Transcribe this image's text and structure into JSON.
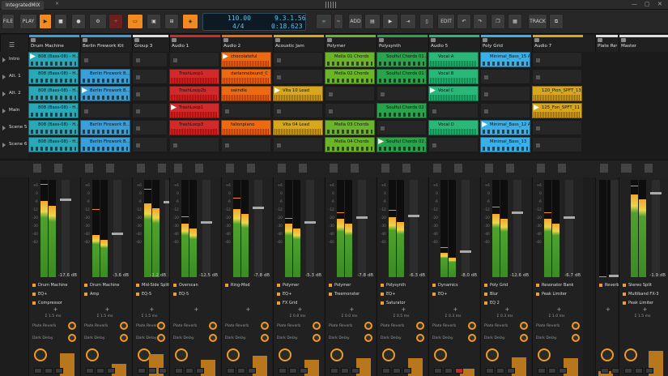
{
  "window": {
    "tab_title": "IntegratedMIX",
    "tab_close": "×",
    "controls": [
      "—",
      "▢",
      "✕"
    ]
  },
  "toolbar": {
    "file": "FILE",
    "play_label": "PLAY",
    "add": "ADD",
    "edit": "EDIT",
    "track": "TRACK"
  },
  "transport": {
    "tempo": "110.00",
    "signature": "4/4",
    "position": "9.3.1.56",
    "time": "0:18.623"
  },
  "tracks": [
    {
      "name": "Drum Machine",
      "color": "#3a9fd8"
    },
    {
      "name": "Berlin Firework Kit",
      "color": "#3a9fd8"
    },
    {
      "name": "Group 3",
      "color": "#dedede"
    },
    {
      "name": "Audio 1",
      "color": "#d02a2a"
    },
    {
      "name": "Audio 2",
      "color": "#ec6a12"
    },
    {
      "name": "Acoustic Jam",
      "color": "#d7a81e"
    },
    {
      "name": "Polymer",
      "color": "#6bb52a"
    },
    {
      "name": "Polysynth",
      "color": "#2aa34c"
    },
    {
      "name": "Audio 5",
      "color": "#2ab87a"
    },
    {
      "name": "Poly Grid",
      "color": "#3bb0e8"
    },
    {
      "name": "Audio 7",
      "color": "#d7a81e"
    },
    {
      "name": "Plate Reverb",
      "color": "#dedede"
    },
    {
      "name": "Master",
      "color": "#dedede"
    }
  ],
  "scenes": [
    "Intro",
    "Alt. 1",
    "Alt. 2",
    "Main",
    "Scene 5",
    "Scene 6"
  ],
  "clips": [
    {
      "t": 0,
      "s": 0,
      "name": "808 (Bass-08) - H...",
      "color": "#2aa8b8",
      "play": true
    },
    {
      "t": 0,
      "s": 1,
      "name": "808 (Bass-08) - H...",
      "color": "#2aa8b8"
    },
    {
      "t": 0,
      "s": 2,
      "name": "808 (Bass-08) - H...",
      "color": "#2aa8b8"
    },
    {
      "t": 0,
      "s": 3,
      "name": "808 (Bass-08) - H...",
      "color": "#2aa8b8"
    },
    {
      "t": 0,
      "s": 4,
      "name": "808 (Bass-08) - H...",
      "color": "#2aa8b8"
    },
    {
      "t": 0,
      "s": 5,
      "name": "808 (Bass-08) - H...",
      "color": "#2aa8b8"
    },
    {
      "t": 1,
      "s": 1,
      "name": "Berlin Firework B...",
      "color": "#3a9fd8"
    },
    {
      "t": 1,
      "s": 2,
      "name": "Berlin Firework B...",
      "color": "#3a9fd8",
      "play": true
    },
    {
      "t": 1,
      "s": 4,
      "name": "Berlin Firework B...",
      "color": "#3a9fd8"
    },
    {
      "t": 1,
      "s": 5,
      "name": "Berlin Firework B...",
      "color": "#3a9fd8"
    },
    {
      "t": 3,
      "s": 1,
      "name": "TrashLoop1",
      "color": "#d02a2a"
    },
    {
      "t": 3,
      "s": 2,
      "name": "TrashLoop2b",
      "color": "#d02a2a"
    },
    {
      "t": 3,
      "s": 3,
      "name": "TrashLoop1",
      "color": "#d02a2a",
      "play": true
    },
    {
      "t": 3,
      "s": 4,
      "name": "TrashLoop3",
      "color": "#d02a2a"
    },
    {
      "t": 4,
      "s": 0,
      "name": "chocolateful",
      "color": "#ec6a12",
      "play": true
    },
    {
      "t": 4,
      "s": 1,
      "name": "darlannebsund_C",
      "color": "#ec6a12"
    },
    {
      "t": 4,
      "s": 2,
      "name": "swindle",
      "color": "#ec6a12"
    },
    {
      "t": 4,
      "s": 4,
      "name": "fallonpiano",
      "color": "#ec6a12"
    },
    {
      "t": 5,
      "s": 2,
      "name": "Vita 10 Lead",
      "color": "#d7a81e",
      "play": true
    },
    {
      "t": 5,
      "s": 4,
      "name": "Vita 04 Lead",
      "color": "#d7a81e"
    },
    {
      "t": 6,
      "s": 0,
      "name": "Mella 01 Chords",
      "color": "#6bb52a"
    },
    {
      "t": 6,
      "s": 1,
      "name": "Mella 02 Chords",
      "color": "#6bb52a"
    },
    {
      "t": 6,
      "s": 4,
      "name": "Mella 03 Chords",
      "color": "#6bb52a"
    },
    {
      "t": 6,
      "s": 5,
      "name": "Mella 04 Chords",
      "color": "#6bb52a"
    },
    {
      "t": 7,
      "s": 0,
      "name": "Soulful Chords 01 A",
      "color": "#2aa34c"
    },
    {
      "t": 7,
      "s": 1,
      "name": "Soulful Chords 01 B",
      "color": "#2aa34c"
    },
    {
      "t": 7,
      "s": 3,
      "name": "Soulful Chords 02 B",
      "color": "#2aa34c"
    },
    {
      "t": 7,
      "s": 5,
      "name": "Soulful Chords 02 A",
      "color": "#2aa34c",
      "play": true
    },
    {
      "t": 8,
      "s": 0,
      "name": "Vocal A",
      "color": "#2ab87a"
    },
    {
      "t": 8,
      "s": 1,
      "name": "Vocal B",
      "color": "#2ab87a"
    },
    {
      "t": 8,
      "s": 2,
      "name": "Vocal C",
      "color": "#2ab87a",
      "play": true
    },
    {
      "t": 8,
      "s": 4,
      "name": "Vocal D",
      "color": "#2ab87a"
    },
    {
      "t": 9,
      "s": 0,
      "name": "Minimal_Bass_15 A",
      "color": "#3bb0e8"
    },
    {
      "t": 9,
      "s": 4,
      "name": "Minimal_Bass_12 A",
      "color": "#3bb0e8",
      "play": true
    },
    {
      "t": 9,
      "s": 5,
      "name": "Minimal_Bass_13",
      "color": "#3bb0e8"
    },
    {
      "t": 10,
      "s": 2,
      "name": "120_Pion_SPFT_13",
      "color": "#d7a81e"
    },
    {
      "t": 10,
      "s": 3,
      "name": "125_Fon_SPFT_11",
      "color": "#d7a81e",
      "play": true
    }
  ],
  "mixer": [
    {
      "db": "-17.6 dB",
      "level": 0.78,
      "peak": 0.95,
      "d1": "Drum Machine",
      "d2": "EQ+",
      "d3": "Compressor",
      "lat": "Σ 1.5 ms",
      "k1": "Plate Reverb",
      "k2": "Dark Delay"
    },
    {
      "db": "-3.6 dB",
      "level": 0.43,
      "peak": 0.69,
      "d1": "Drum Machine",
      "d2": "Amp",
      "d3": "",
      "lat": "Σ 1.5 ms",
      "k1": "Plate Reverb",
      "k2": "Dark Delay"
    },
    {
      "db": "-2.2 dB",
      "level": 0.76,
      "peak": 0.9,
      "d1": "Mid-Side Split",
      "d2": "EQ-5",
      "d3": "",
      "lat": "Σ 1.5 ms",
      "k1": "Plate Reverb",
      "k2": "Dark Delay"
    },
    {
      "db": "-12.5 dB",
      "level": 0.55,
      "peak": 0.62,
      "d1": "Overscan",
      "d2": "EQ-5",
      "d3": "",
      "lat": "",
      "k1": "Plate Reverb",
      "k2": "Dark Delay"
    },
    {
      "db": "-7.8 dB",
      "level": 0.7,
      "peak": 0.81,
      "d1": "Ring-Mod",
      "d2": "",
      "d3": "",
      "lat": "",
      "k1": "Plate Reverb",
      "k2": "Dark Delay"
    },
    {
      "db": "-5.3 dB",
      "level": 0.55,
      "peak": 0.6,
      "d1": "Polymer",
      "d2": "EQ+",
      "d3": "FX Grid",
      "lat": "Σ 0.8 ms",
      "k1": "Plate Reverb",
      "k2": "Dark Delay"
    },
    {
      "db": "-7.8 dB",
      "level": 0.6,
      "peak": 0.66,
      "d1": "Polymer",
      "d2": "Treemonster",
      "d3": "",
      "lat": "Σ 0.0 ms",
      "k1": "Plate Reverb",
      "k2": "Dark Delay"
    },
    {
      "db": "-6.3 dB",
      "level": 0.62,
      "peak": 0.68,
      "d1": "Polysynth",
      "d2": "EQ+",
      "d3": "Saturator",
      "lat": "Σ 0.5 ms",
      "k1": "Plate Reverb",
      "k2": "Dark Delay"
    },
    {
      "db": "-8.0 dB",
      "level": 0.25,
      "peak": 0.3,
      "d1": "Dynamics",
      "d2": "EQ+",
      "d3": "",
      "lat": "Σ 0.3 ms",
      "k1": "Plate Reverb",
      "k2": "Dark Delay"
    },
    {
      "db": "-12.6 dB",
      "level": 0.65,
      "peak": 0.72,
      "d1": "Poly Grid",
      "d2": "Blur",
      "d3": "EQ 2",
      "lat": "Σ 0.3 ms",
      "k1": "Plate Reverb",
      "k2": "Dark Delay"
    },
    {
      "db": "-6.7 dB",
      "level": 0.6,
      "peak": 0.66,
      "d1": "Resonator Bank",
      "d2": "Peak Limiter",
      "d3": "",
      "lat": "Σ 1.0 ms",
      "k1": "Plate Reverb",
      "k2": "Dark Delay"
    },
    {
      "db": "",
      "level": 0.0,
      "peak": 0.0,
      "d1": "Reverb",
      "d2": "",
      "d3": "",
      "lat": "",
      "k1": "",
      "k2": ""
    },
    {
      "db": "-1.9 dB",
      "level": 0.85,
      "peak": 0.93,
      "d1": "Stereo Split",
      "d2": "Multiband FX-3",
      "d3": "Peak Limiter",
      "lat": "Σ 1.5 ms",
      "k1": "",
      "k2": ""
    }
  ],
  "scale": [
    "+6",
    "0",
    "-6",
    "-12",
    "-20",
    "-30",
    "-40",
    "-60"
  ]
}
